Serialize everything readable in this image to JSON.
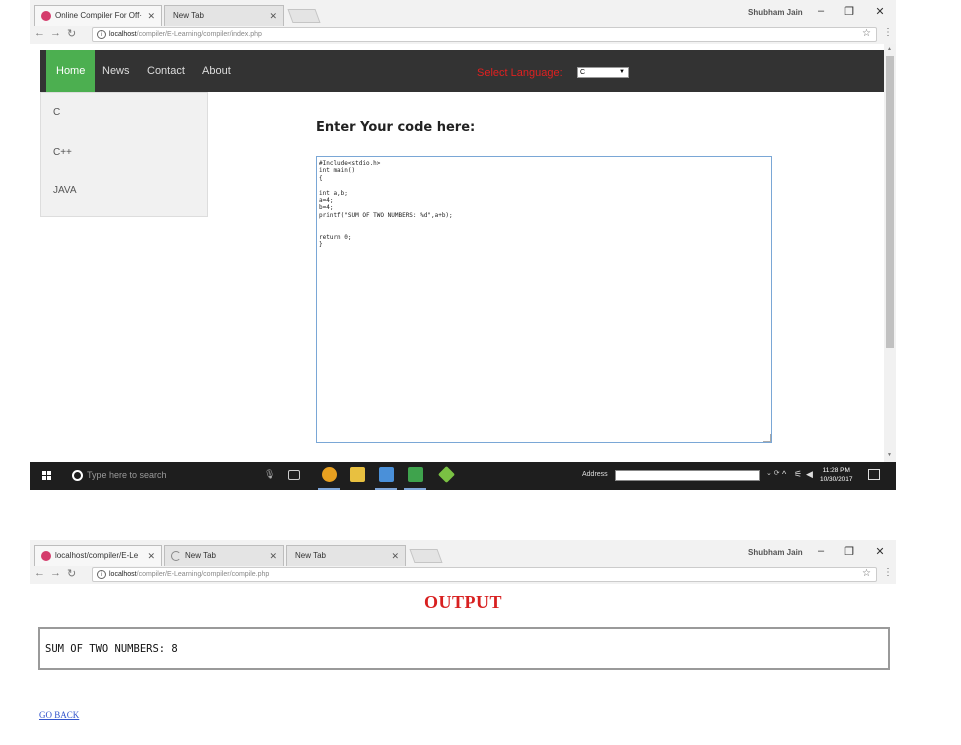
{
  "window1": {
    "tabs": [
      {
        "title": "Online Compiler For Off·"
      },
      {
        "title": "New Tab"
      }
    ],
    "profile": "Shubham Jain",
    "address": {
      "host": "localhost",
      "path": "/compiler/E-Learning/compiler/index.php"
    },
    "navbar": {
      "links": [
        "Home",
        "News",
        "Contact",
        "About"
      ],
      "language_label": "Select Language:",
      "language_value": "C"
    },
    "sidebar": {
      "items": [
        "C",
        "C++",
        "JAVA"
      ]
    },
    "code_heading": "Enter Your code here:",
    "code": "#Include<stdio.h>\nint main()\n{\n\nint a,b;\na=4;\nb=4;\nprintf(\"SUM OF TWO NUMBERS: %d\",a+b);\n\n\nreturn 0;\n}"
  },
  "taskbar": {
    "search_placeholder": "Type here to search",
    "address_label": "Address",
    "time": "11:28 PM",
    "date": "10/30/2017"
  },
  "window2": {
    "tabs": [
      {
        "title": "localhost/compiler/E-Le"
      },
      {
        "title": "New Tab"
      },
      {
        "title": "New Tab"
      }
    ],
    "profile": "Shubham Jain",
    "address": {
      "host": "localhost",
      "path": "/compiler/E-Learning/compiler/compile.php"
    },
    "output_title": "OUTPUT",
    "output_text": "SUM OF TWO NUMBERS: 8",
    "go_back": "GO BACK"
  },
  "colors": {
    "nav_active": "#4caf50",
    "navbar_bg": "#333333",
    "accent_red": "#d82020",
    "link_blue": "#3355cc"
  }
}
